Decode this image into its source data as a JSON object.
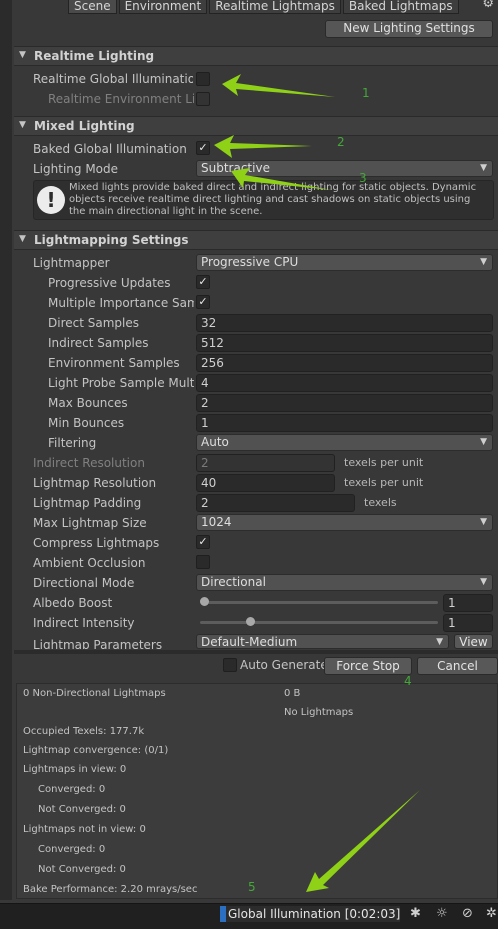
{
  "tabs": [
    "Scene",
    "Environment",
    "Realtime Lightmaps",
    "Baked Lightmaps"
  ],
  "header": {
    "new_lighting_settings": "New Lighting Settings"
  },
  "realtime": {
    "title": "Realtime Lighting",
    "gi_label": "Realtime Global Illumination (",
    "gi_checked": false,
    "env_label": "Realtime Environment Ligh",
    "env_checked": false
  },
  "mixed": {
    "title": "Mixed Lighting",
    "bgi_label": "Baked Global Illumination",
    "bgi_checked": true,
    "mode_label": "Lighting Mode",
    "mode_value": "Subtractive",
    "info": "Mixed lights provide baked direct and indirect lighting for static objects. Dynamic objects receive realtime direct lighting and cast shadows on static objects using the main directional light in the scene."
  },
  "lightmapping": {
    "title": "Lightmapping Settings",
    "lightmapper_label": "Lightmapper",
    "lightmapper_value": "Progressive CPU",
    "progressive_updates_label": "Progressive Updates",
    "progressive_updates_checked": true,
    "mis_label": "Multiple Importance Samp",
    "mis_checked": true,
    "direct_samples_label": "Direct Samples",
    "direct_samples_value": "32",
    "indirect_samples_label": "Indirect Samples",
    "indirect_samples_value": "512",
    "env_samples_label": "Environment Samples",
    "env_samples_value": "256",
    "light_probe_label": "Light Probe Sample Multip",
    "light_probe_value": "4",
    "max_bounces_label": "Max Bounces",
    "max_bounces_value": "2",
    "min_bounces_label": "Min Bounces",
    "min_bounces_value": "1",
    "filtering_label": "Filtering",
    "filtering_value": "Auto",
    "indirect_res_label": "Indirect Resolution",
    "indirect_res_value": "2",
    "indirect_res_unit": "texels per unit",
    "lm_res_label": "Lightmap Resolution",
    "lm_res_value": "40",
    "lm_res_unit": "texels per unit",
    "lm_padding_label": "Lightmap Padding",
    "lm_padding_value": "2",
    "lm_padding_unit": "texels",
    "max_size_label": "Max Lightmap Size",
    "max_size_value": "1024",
    "compress_label": "Compress Lightmaps",
    "compress_checked": true,
    "ao_label": "Ambient Occlusion",
    "ao_checked": false,
    "dir_mode_label": "Directional Mode",
    "dir_mode_value": "Directional",
    "albedo_label": "Albedo Boost",
    "albedo_value": "1",
    "albedo_fraction": 0.0,
    "indirect_int_label": "Indirect Intensity",
    "indirect_int_value": "1",
    "indirect_int_fraction": 0.2,
    "params_label": "Lightmap Parameters",
    "params_value": "Default-Medium",
    "view_label": "View"
  },
  "bake": {
    "auto_generate_label": "Auto Generate",
    "auto_generate_checked": false,
    "force_stop_label": "Force Stop",
    "cancel_label": "Cancel"
  },
  "stats": {
    "non_directional": "0 Non-Directional Lightmaps",
    "size": "0 B",
    "no_lightmaps": "No Lightmaps",
    "occupied": "Occupied Texels: 177.7k",
    "convergence": "Lightmap convergence: (0/1)",
    "in_view": "Lightmaps in view: 0",
    "in_view_converged": "Converged: 0",
    "in_view_not_converged": "Not Converged: 0",
    "not_in_view": "Lightmaps not in view: 0",
    "not_in_view_converged": "Converged: 0",
    "not_in_view_not_converged": "Not Converged: 0",
    "performance": "Bake Performance: 2.20 mrays/sec"
  },
  "status": {
    "gi_progress": "Global Illumination [0:02:03]"
  },
  "annotations": [
    "1",
    "2",
    "3",
    "4",
    "5"
  ],
  "colors": {
    "annotation_arrow": "#8fd117",
    "annotation_number": "#44a838",
    "progress_mark": "#2b6fc0"
  }
}
